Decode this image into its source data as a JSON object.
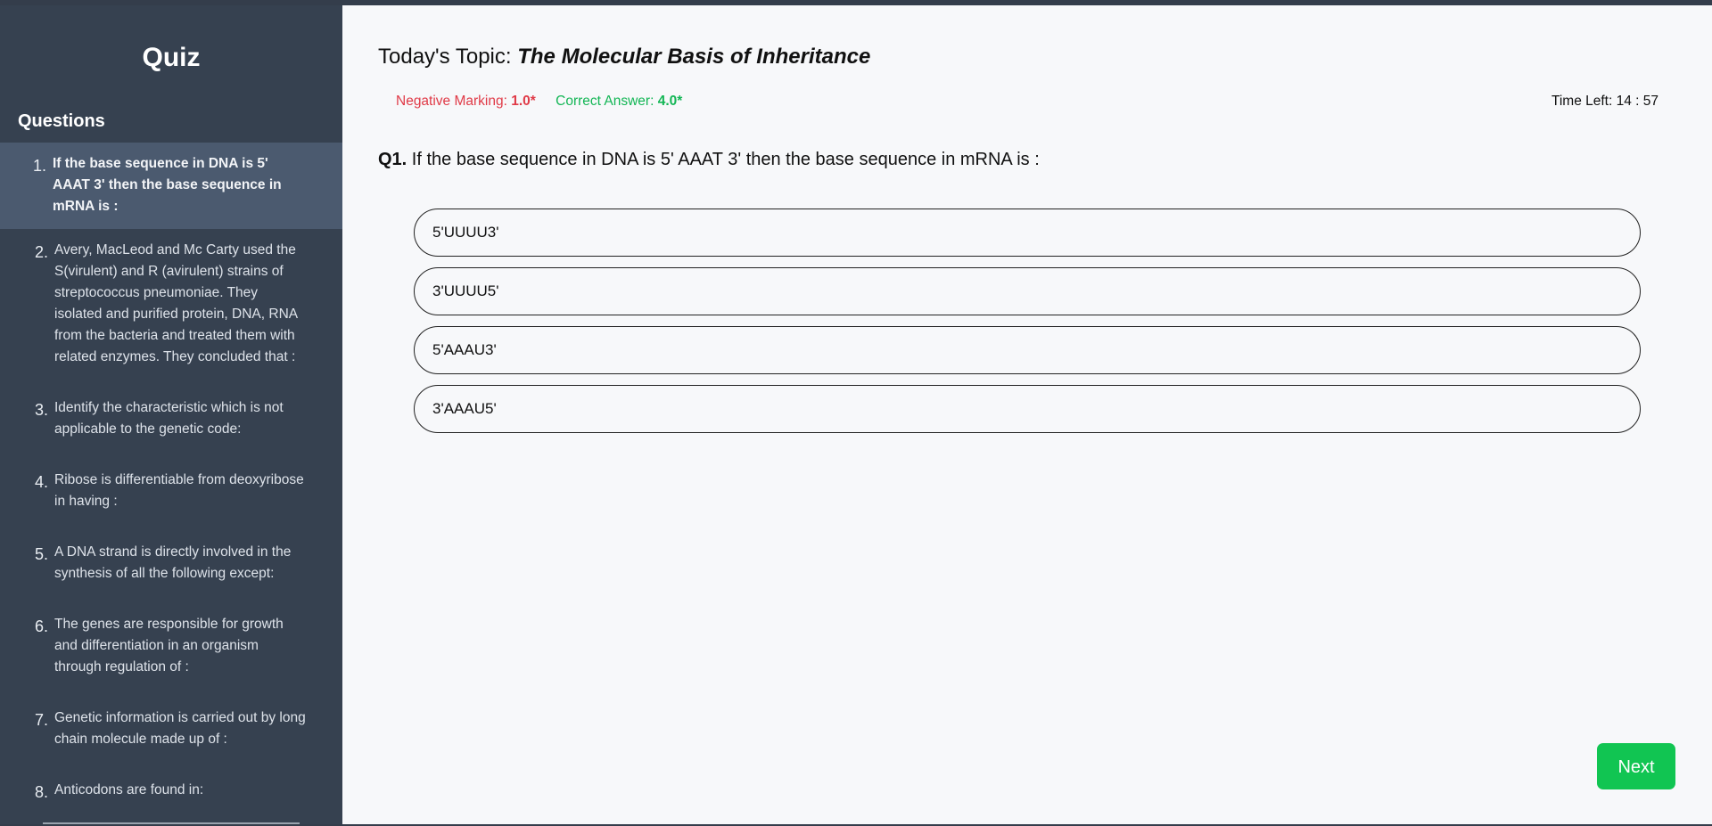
{
  "sidebar": {
    "title": "Quiz",
    "heading": "Questions",
    "items": [
      {
        "num": "1.",
        "text": "If the base sequence in DNA is 5' AAAT 3' then the base sequence in mRNA is :"
      },
      {
        "num": "2.",
        "text": "Avery, MacLeod and Mc Carty used the S(virulent) and R (avirulent) strains of streptococcus pneumoniae. They isolated and purified protein, DNA, RNA from the bacteria and treated them with related enzymes. They concluded that :"
      },
      {
        "num": "3.",
        "text": "Identify the characteristic which is not applicable to the genetic code:"
      },
      {
        "num": "4.",
        "text": "Ribose is differentiable from deoxyribose in having :"
      },
      {
        "num": "5.",
        "text": "A DNA strand is directly involved in the synthesis of all the following except:"
      },
      {
        "num": "6.",
        "text": "The genes are responsible for growth and differentiation in an organism through regulation of :"
      },
      {
        "num": "7.",
        "text": "Genetic information is carried out by long chain molecule made up of :"
      },
      {
        "num": "8.",
        "text": "Anticodons are found in:"
      }
    ]
  },
  "main": {
    "topic_prefix": "Today's Topic: ",
    "topic_name": "The Molecular Basis of Inheritance",
    "negative_label": "Negative Marking: ",
    "negative_value": "1.0*",
    "correct_label": "Correct Answer: ",
    "correct_value": "4.0*",
    "timer": "Time Left: 14 : 57",
    "question_num": "Q1.",
    "question_text": " If the base sequence in DNA is 5' AAAT 3' then the base sequence in mRNA is :",
    "options": [
      "5'UUUU3'",
      "3'UUUU5'",
      "5'AAAU3'",
      "3'AAAU5'"
    ],
    "next_label": "Next"
  },
  "colors": {
    "sidebar_bg": "#364150",
    "active_item_bg": "#4b5a6f",
    "negative": "#e03a47",
    "correct": "#13b655",
    "next_button": "#11c552"
  }
}
